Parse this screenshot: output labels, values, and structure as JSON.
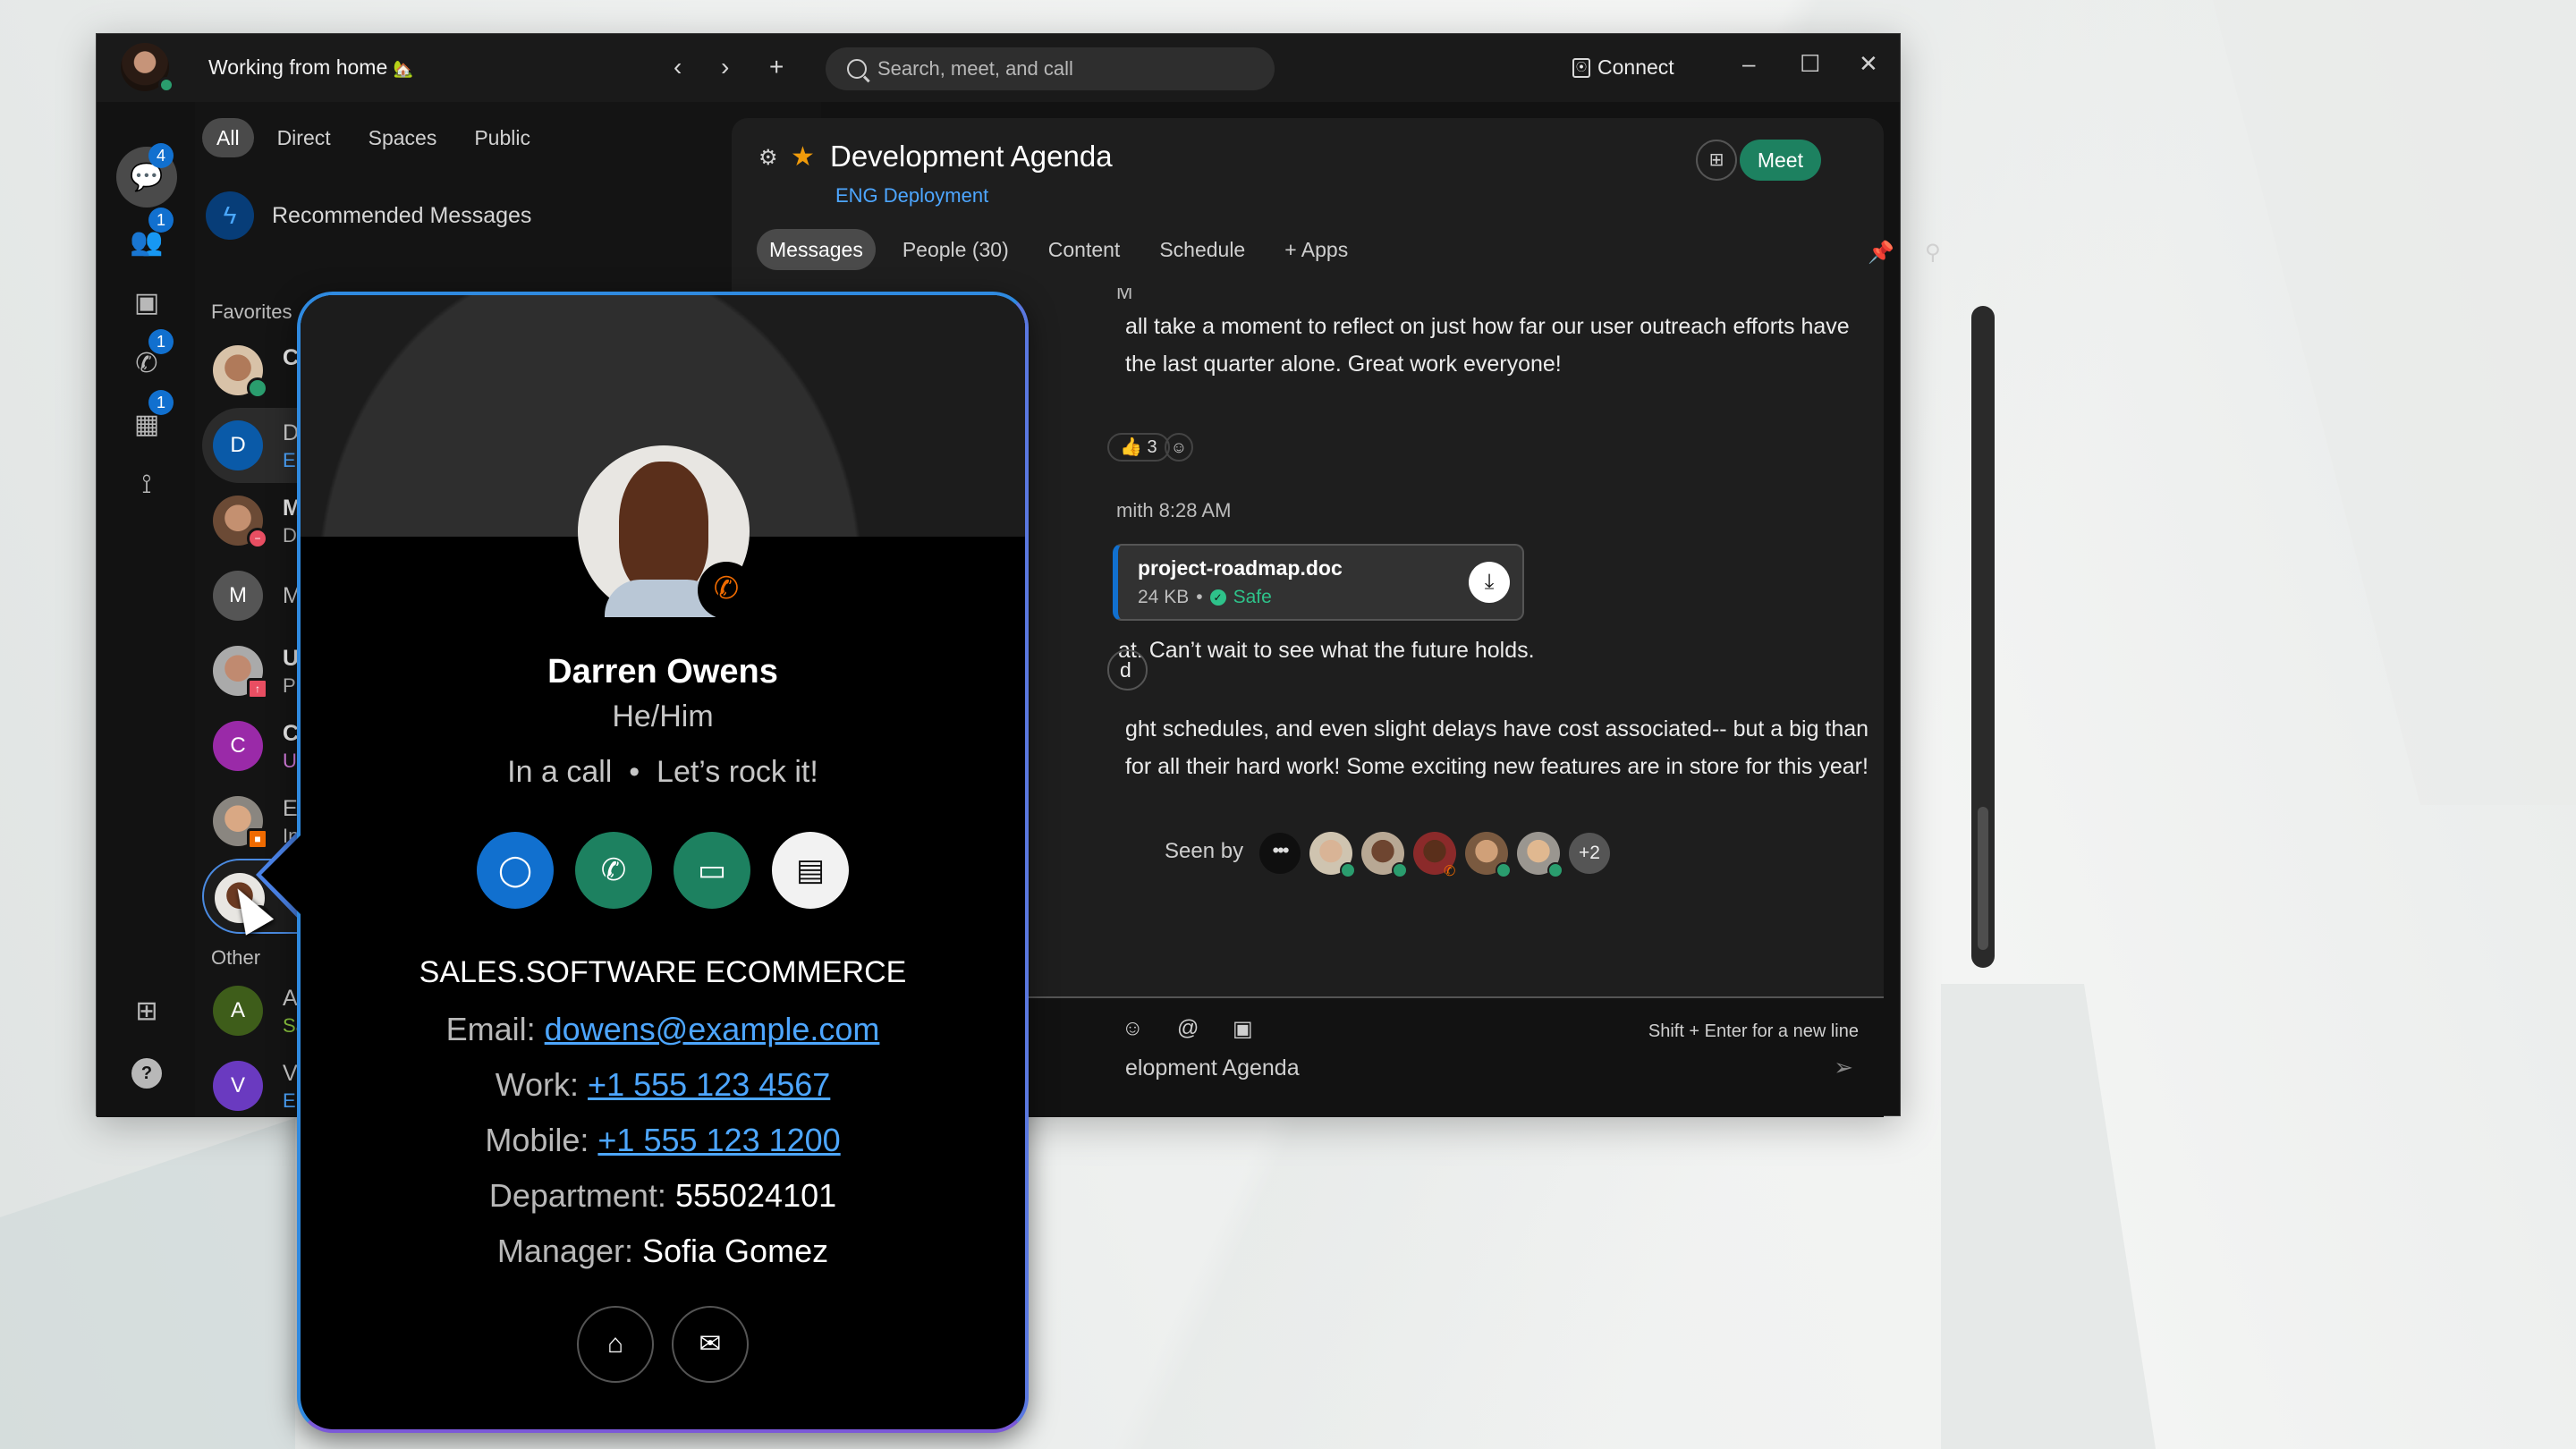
{
  "titlebar": {
    "status": "Working from home",
    "status_emoji": "🏡",
    "back_icon": "chevron-left",
    "forward_icon": "chevron-right",
    "new_icon": "plus",
    "search_placeholder": "Search, meet, and call",
    "connect_label": "Connect",
    "minimize": "–",
    "maximize": "☐",
    "close": "✕"
  },
  "rail": {
    "items": [
      {
        "name": "messaging",
        "icon": "💬",
        "badge": "4",
        "active": true
      },
      {
        "name": "teams",
        "icon": "👥",
        "badge": "1"
      },
      {
        "name": "contacts",
        "icon": "📇",
        "badge": ""
      },
      {
        "name": "calling",
        "icon": "📞",
        "badge": "1"
      },
      {
        "name": "meetings",
        "icon": "📅",
        "badge": "1"
      },
      {
        "name": "workflows",
        "icon": "⋰",
        "badge": ""
      }
    ],
    "apps_icon": "▦",
    "help_icon": "?"
  },
  "list": {
    "filters": [
      "All",
      "Direct",
      "Spaces",
      "Public"
    ],
    "active_filter": "All",
    "recommended": "Recommended Messages",
    "favorites_label": "Favorites",
    "other_label": "Other",
    "favorites": [
      {
        "initial": "",
        "name": "Cl",
        "sub": "",
        "status": "available"
      },
      {
        "initial": "D",
        "name": "De",
        "sub": "EN",
        "sub_color": "#4da6ff",
        "avatar_color": "#0a5aa8",
        "selected": true
      },
      {
        "initial": "",
        "name": "Ma",
        "sub": "Do",
        "status": "dnd"
      },
      {
        "initial": "M",
        "name": "Ma",
        "sub": "",
        "avatar_color": "#555555"
      },
      {
        "initial": "",
        "name": "Ur",
        "sub": "Pre",
        "status": "presenting"
      },
      {
        "initial": "C",
        "name": "Co",
        "sub": "Usa",
        "sub_color": "#d77ee0",
        "avatar_color": "#9a2aa8"
      },
      {
        "initial": "",
        "name": "Em",
        "sub": "In a",
        "status": "meeting"
      },
      {
        "initial": "",
        "name": "",
        "sub": "",
        "status": "call",
        "hovered": true
      }
    ],
    "other": [
      {
        "initial": "A",
        "name": "Ac",
        "sub": "Sal",
        "sub_color": "#8cc63f",
        "avatar_color": "#3e5d1a"
      },
      {
        "initial": "V",
        "name": "Vis",
        "sub": "EN",
        "sub_color": "#4da6ff",
        "avatar_color": "#6a3ac0"
      }
    ]
  },
  "space": {
    "title": "Development Agenda",
    "team": "ENG Deployment",
    "favorite": true,
    "schedule_icon": "calendar-plus",
    "meet_label": "Meet",
    "tabs": [
      "Messages",
      "People (30)",
      "Content",
      "Schedule",
      "+ Apps"
    ],
    "active_tab": "Messages"
  },
  "messages": {
    "msg1_meta": "M",
    "msg1_line1": "all take a moment to reflect on just how far our user outreach efforts have",
    "msg1_line2": "the last quarter alone. Great work everyone!",
    "reaction_count": "3",
    "msg2_meta": "mith  8:28 AM",
    "file": {
      "name": "project-roadmap.doc",
      "size": "24 KB",
      "status": "Safe"
    },
    "msg2_text": "at. Can’t wait to see what the future holds.",
    "pill": "d",
    "msg3_line1": "ght schedules, and even slight delays have cost associated-- but a big thank",
    "msg3_line2": " for all their hard work! Some exciting new features are in store for this year!",
    "seen_label": "Seen by",
    "seen_more": "+2"
  },
  "composer": {
    "placeholder": "elopment Agenda",
    "hint": "Shift + Enter for a new line"
  },
  "contact_card": {
    "name": "Darren Owens",
    "pronouns": "He/Him",
    "status": "In a call",
    "status_message": "Let’s rock it!",
    "organization": "SALES.SOFTWARE ECOMMERCE",
    "email_label": "Email:",
    "email": "dowens@example.com",
    "work_label": "Work:",
    "work": "+1 555 123 4567",
    "mobile_label": "Mobile:",
    "mobile": "+1 555 123 1200",
    "department_label": "Department:",
    "department": "555024101",
    "manager_label": "Manager:",
    "manager": "Sofia Gomez",
    "colors": {
      "message": "#1170cf",
      "call": "#1d8160",
      "video": "#1d8160",
      "in_call": "#ef6a00"
    }
  }
}
